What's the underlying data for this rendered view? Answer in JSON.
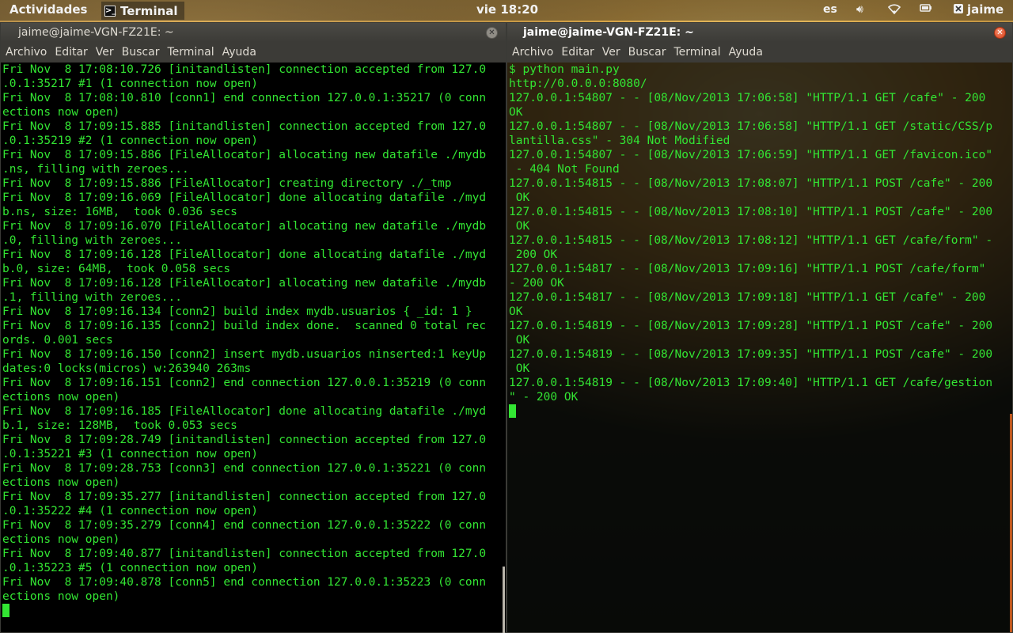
{
  "top_panel": {
    "activities": "Actividades",
    "app_name": "Terminal",
    "clock": "vie 18:20",
    "language": "es",
    "user": "jaime"
  },
  "left_window": {
    "title": "jaime@jaime-VGN-FZ21E: ~",
    "menu": [
      "Archivo",
      "Editar",
      "Ver",
      "Buscar",
      "Terminal",
      "Ayuda"
    ],
    "lines": [
      "Fri Nov  8 17:08:10.726 [initandlisten] connection accepted from 127.0",
      ".0.1:35217 #1 (1 connection now open)",
      "Fri Nov  8 17:08:10.810 [conn1] end connection 127.0.0.1:35217 (0 conn",
      "ections now open)",
      "Fri Nov  8 17:09:15.885 [initandlisten] connection accepted from 127.0",
      ".0.1:35219 #2 (1 connection now open)",
      "Fri Nov  8 17:09:15.886 [FileAllocator] allocating new datafile ./mydb",
      ".ns, filling with zeroes...",
      "Fri Nov  8 17:09:15.886 [FileAllocator] creating directory ./_tmp",
      "Fri Nov  8 17:09:16.069 [FileAllocator] done allocating datafile ./myd",
      "b.ns, size: 16MB,  took 0.036 secs",
      "Fri Nov  8 17:09:16.070 [FileAllocator] allocating new datafile ./mydb",
      ".0, filling with zeroes...",
      "Fri Nov  8 17:09:16.128 [FileAllocator] done allocating datafile ./myd",
      "b.0, size: 64MB,  took 0.058 secs",
      "Fri Nov  8 17:09:16.128 [FileAllocator] allocating new datafile ./mydb",
      ".1, filling with zeroes...",
      "Fri Nov  8 17:09:16.134 [conn2] build index mydb.usuarios { _id: 1 }",
      "Fri Nov  8 17:09:16.135 [conn2] build index done.  scanned 0 total rec",
      "ords. 0.001 secs",
      "Fri Nov  8 17:09:16.150 [conn2] insert mydb.usuarios ninserted:1 keyUp",
      "dates:0 locks(micros) w:263940 263ms",
      "Fri Nov  8 17:09:16.151 [conn2] end connection 127.0.0.1:35219 (0 conn",
      "ections now open)",
      "Fri Nov  8 17:09:16.185 [FileAllocator] done allocating datafile ./myd",
      "b.1, size: 128MB,  took 0.053 secs",
      "Fri Nov  8 17:09:28.749 [initandlisten] connection accepted from 127.0",
      ".0.1:35221 #3 (1 connection now open)",
      "Fri Nov  8 17:09:28.753 [conn3] end connection 127.0.0.1:35221 (0 conn",
      "ections now open)",
      "Fri Nov  8 17:09:35.277 [initandlisten] connection accepted from 127.0",
      ".0.1:35222 #4 (1 connection now open)",
      "Fri Nov  8 17:09:35.279 [conn4] end connection 127.0.0.1:35222 (0 conn",
      "ections now open)",
      "Fri Nov  8 17:09:40.877 [initandlisten] connection accepted from 127.0",
      ".0.1:35223 #5 (1 connection now open)",
      "Fri Nov  8 17:09:40.878 [conn5] end connection 127.0.0.1:35223 (0 conn",
      "ections now open)"
    ]
  },
  "right_window": {
    "title": "jaime@jaime-VGN-FZ21E: ~",
    "menu": [
      "Archivo",
      "Editar",
      "Ver",
      "Buscar",
      "Terminal",
      "Ayuda"
    ],
    "lines": [
      "$ python main.py",
      "http://0.0.0.0:8080/",
      "127.0.0.1:54807 - - [08/Nov/2013 17:06:58] \"HTTP/1.1 GET /cafe\" - 200",
      "OK",
      "127.0.0.1:54807 - - [08/Nov/2013 17:06:58] \"HTTP/1.1 GET /static/CSS/p",
      "lantilla.css\" - 304 Not Modified",
      "127.0.0.1:54807 - - [08/Nov/2013 17:06:59] \"HTTP/1.1 GET /favicon.ico\"",
      " - 404 Not Found",
      "127.0.0.1:54815 - - [08/Nov/2013 17:08:07] \"HTTP/1.1 POST /cafe\" - 200",
      " OK",
      "127.0.0.1:54815 - - [08/Nov/2013 17:08:10] \"HTTP/1.1 POST /cafe\" - 200",
      " OK",
      "127.0.0.1:54815 - - [08/Nov/2013 17:08:12] \"HTTP/1.1 GET /cafe/form\" -",
      " 200 OK",
      "127.0.0.1:54817 - - [08/Nov/2013 17:09:16] \"HTTP/1.1 POST /cafe/form\"",
      "- 200 OK",
      "127.0.0.1:54817 - - [08/Nov/2013 17:09:18] \"HTTP/1.1 GET /cafe\" - 200",
      "OK",
      "127.0.0.1:54819 - - [08/Nov/2013 17:09:28] \"HTTP/1.1 POST /cafe\" - 200",
      " OK",
      "127.0.0.1:54819 - - [08/Nov/2013 17:09:35] \"HTTP/1.1 POST /cafe\" - 200",
      " OK",
      "127.0.0.1:54819 - - [08/Nov/2013 17:09:40] \"HTTP/1.1 GET /cafe/gestion",
      "\" - 200 OK"
    ]
  }
}
